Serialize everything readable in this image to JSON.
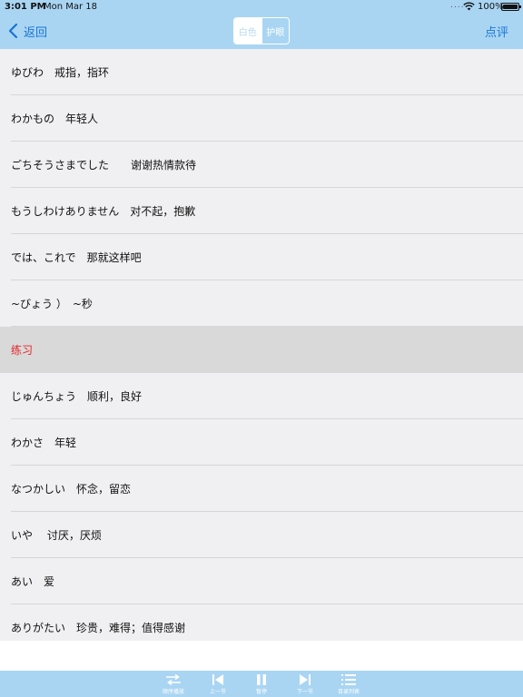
{
  "status_bar": {
    "time": "3:01 PM",
    "date": "Mon Mar 18",
    "signal": "....",
    "battery": "100%"
  },
  "nav": {
    "back_label": "返回",
    "segment_white": "白色",
    "segment_eye": "护眼",
    "review_label": "点评"
  },
  "list": {
    "rows": [
      {
        "text": "ゆびわ　戒指，指环",
        "type": "item"
      },
      {
        "text": "わかもの　年轻人",
        "type": "item"
      },
      {
        "text": "ごちそうさまでした　　谢谢热情款待",
        "type": "item"
      },
      {
        "text": "もうしわけありません　对不起，抱歉",
        "type": "item"
      },
      {
        "text": "では、これで　那就这样吧",
        "type": "item"
      },
      {
        "text": "~びょう ）　~秒",
        "type": "item"
      },
      {
        "text": "练习",
        "type": "section"
      },
      {
        "text": "じゅんちょう　顺利，良好",
        "type": "item"
      },
      {
        "text": "わかさ　年轻",
        "type": "item"
      },
      {
        "text": "なつかしい　怀念，留恋",
        "type": "item"
      },
      {
        "text": "いや　 讨厌，厌烦",
        "type": "item"
      },
      {
        "text": "あい　爱",
        "type": "item"
      },
      {
        "text": "ありがたい　珍贵，难得；值得感谢",
        "type": "item"
      }
    ]
  },
  "toolbar": {
    "items": [
      {
        "label": "顺序播放",
        "icon": "shuffle-icon"
      },
      {
        "label": "上一节",
        "icon": "previous-icon"
      },
      {
        "label": "暂停",
        "icon": "pause-icon"
      },
      {
        "label": "下一节",
        "icon": "next-icon"
      },
      {
        "label": "目录列表",
        "icon": "list-icon"
      }
    ]
  },
  "colors": {
    "nav_background": "#a9d5f3",
    "accent_blue": "#1a73d6",
    "section_red": "#e8262a",
    "section_background": "#d9d9d9"
  }
}
